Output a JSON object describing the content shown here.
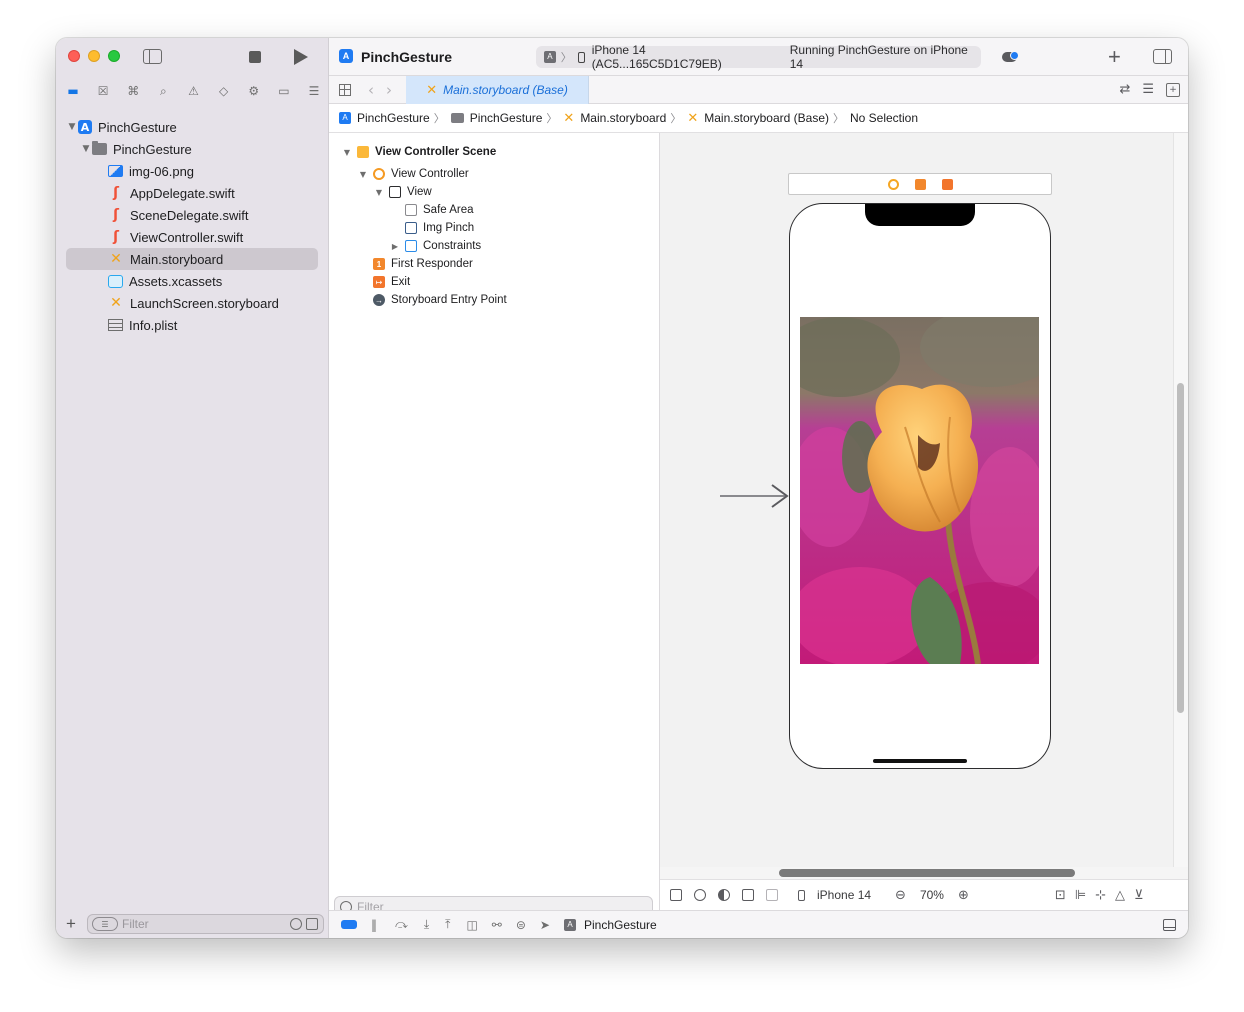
{
  "toolbar": {
    "project_title": "PinchGesture",
    "device": "iPhone 14 (AC5...165C5D1C79EB)",
    "status": "Running PinchGesture on iPhone 14"
  },
  "navigator": {
    "tree": [
      {
        "label": "PinchGesture",
        "icon": "app-icon",
        "level": 0,
        "expanded": true
      },
      {
        "label": "PinchGesture",
        "icon": "folder-icon",
        "level": 1,
        "expanded": true
      },
      {
        "label": "img-06.png",
        "icon": "image-file-icon",
        "level": 2
      },
      {
        "label": "AppDelegate.swift",
        "icon": "swift-file-icon",
        "level": 2
      },
      {
        "label": "SceneDelegate.swift",
        "icon": "swift-file-icon",
        "level": 2
      },
      {
        "label": "ViewController.swift",
        "icon": "swift-file-icon",
        "level": 2
      },
      {
        "label": "Main.storyboard",
        "icon": "storyboard-file-icon",
        "level": 2,
        "selected": true
      },
      {
        "label": "Assets.xcassets",
        "icon": "assets-icon",
        "level": 2
      },
      {
        "label": "LaunchScreen.storyboard",
        "icon": "storyboard-file-icon",
        "level": 2
      },
      {
        "label": "Info.plist",
        "icon": "plist-icon",
        "level": 2
      }
    ],
    "filter_placeholder": "Filter"
  },
  "tab": {
    "active_label": "Main.storyboard (Base)"
  },
  "breadcrumb": {
    "items": [
      "PinchGesture",
      "PinchGesture",
      "Main.storyboard",
      "Main.storyboard (Base)",
      "No Selection"
    ]
  },
  "outline": {
    "rows": [
      {
        "label": "View Controller Scene",
        "icon": "scene-icon",
        "level": 0,
        "disclosure": "expanded",
        "bold": true
      },
      {
        "label": "View Controller",
        "icon": "view-controller-icon",
        "level": 1,
        "disclosure": "expanded"
      },
      {
        "label": "View",
        "icon": "view-icon",
        "level": 2,
        "disclosure": "expanded"
      },
      {
        "label": "Safe Area",
        "icon": "safe-area-icon",
        "level": 3
      },
      {
        "label": "Img Pinch",
        "icon": "image-view-icon",
        "level": 3
      },
      {
        "label": "Constraints",
        "icon": "constraints-icon",
        "level": 3,
        "disclosure": "collapsed"
      },
      {
        "label": "First Responder",
        "icon": "first-responder-icon",
        "level": 1
      },
      {
        "label": "Exit",
        "icon": "exit-icon",
        "level": 1
      },
      {
        "label": "Storyboard Entry Point",
        "icon": "entry-point-icon",
        "level": 1
      }
    ],
    "filter_placeholder": "Filter"
  },
  "canvas_bar": {
    "device": "iPhone 14",
    "zoom": "70%"
  },
  "debug_bar": {
    "target": "PinchGesture"
  },
  "colors": {
    "accent": "#1f7bf2",
    "selection": "#cdc8cf",
    "tab_active_bg": "#d4e6fb",
    "storyboard_icon": "#f0a31a",
    "swift_icon": "#f05138"
  }
}
